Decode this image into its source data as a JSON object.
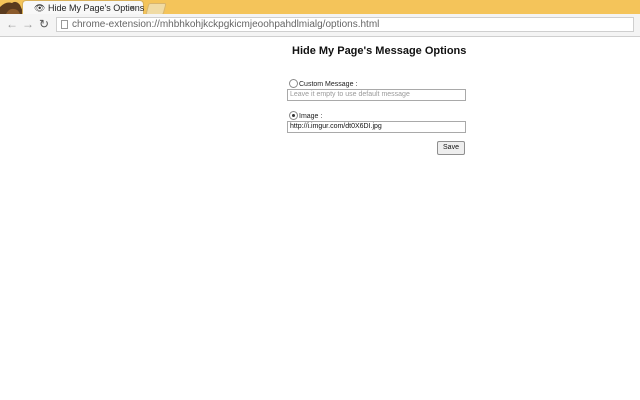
{
  "browser": {
    "tab": {
      "title": "Hide My Page's Options",
      "close": "×"
    },
    "url": "chrome-extension://mhbhkohjkckpgkicmjeoohpahdlmialg/options.html"
  },
  "options": {
    "heading": "Hide My Page's Message Options",
    "custom_message": {
      "label": "Custom Message :",
      "placeholder": "Leave it empty to use default message",
      "selected": false
    },
    "image": {
      "label": "Image :",
      "value": "http://i.imgur.com/dt0X6DI.jpg",
      "selected": true
    },
    "save_label": "Save"
  }
}
